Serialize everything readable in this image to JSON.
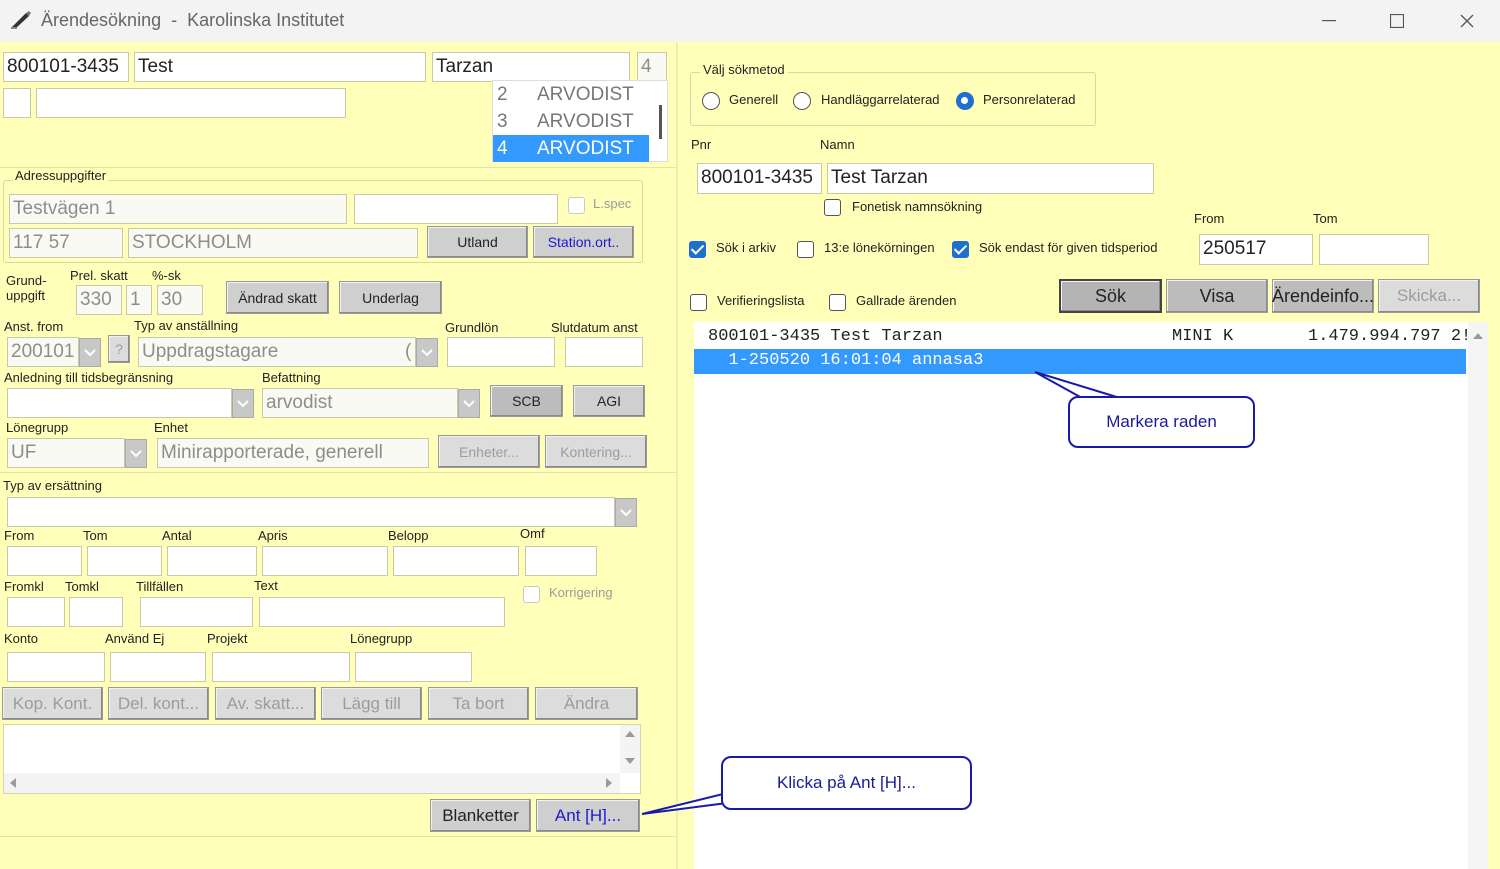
{
  "window": {
    "title": "Ärendesökning",
    "title_sep": "-",
    "title_org": "Karolinska Institutet"
  },
  "left": {
    "pnr": "800101-3435",
    "first_name": "Test",
    "last_name": "Tarzan",
    "count": "4",
    "list": [
      {
        "num": "2",
        "text": "ARVODIST"
      },
      {
        "num": "3",
        "text": "ARVODIST"
      },
      {
        "num": "4",
        "text": "ARVODIST"
      }
    ],
    "address_group": "Adressuppgifter",
    "street": "Testvägen 1",
    "lspec": "L.spec",
    "zip": "117 57",
    "city": "STOCKHOLM",
    "btn_utland": "Utland",
    "btn_stationort": "Station.ort..",
    "grund_label": "Grund-\nuppgift",
    "grund_l1": "Grund-",
    "grund_l2": "uppgift",
    "prel_skatt_label": "Prel. skatt",
    "pct_label": "%-sk",
    "prel_skatt": "330",
    "prel_one": "1",
    "pct": "30",
    "btn_andrad_skatt": "Ändrad skatt",
    "btn_underlag": "Underlag",
    "anst_from_label": "Anst. from",
    "typ_label": "Typ av anställning",
    "grundlon_label": "Grundlön",
    "slutdatum_label": "Slutdatum anst",
    "anst_from": "200101",
    "q_mark": "?",
    "typ": "Uppdragstagare",
    "typ_suffix": "(",
    "anledning_label": "Anledning till tidsbegränsning",
    "befattning_label": "Befattning",
    "befattning": "arvodist",
    "btn_scb": "SCB",
    "btn_agi": "AGI",
    "lonegrupp_label": "Lönegrupp",
    "enhet_label": "Enhet",
    "lonegrupp": "UF",
    "enhet": "Minirapporterade, generell",
    "btn_enheter": "Enheter...",
    "btn_kontering": "Kontering...",
    "ersattning_label": "Typ av ersättning",
    "from_label": "From",
    "tom_label": "Tom",
    "antal_label": "Antal",
    "apris_label": "Apris",
    "belopp_label": "Belopp",
    "omf_label": "Omf",
    "fromkl_label": "Fromkl",
    "tomkl_label": "Tomkl",
    "tillfallen_label": "Tillfällen",
    "text_label": "Text",
    "korrigering_label": "Korrigering",
    "konto_label": "Konto",
    "anvand_ej_label": "Använd Ej",
    "projekt_label": "Projekt",
    "lonegrupp2_label": "Lönegrupp",
    "btn_kop_kont": "Kop. Kont.",
    "btn_del_kont": "Del. kont...",
    "btn_av_skatt": "Av. skatt...",
    "btn_lagg_till": "Lägg till",
    "btn_ta_bort": "Ta bort",
    "btn_andra": "Ändra",
    "btn_blanketter": "Blanketter",
    "btn_ant": "Ant [H]..."
  },
  "right": {
    "method_group": "Välj sökmetod",
    "radio_generell": "Generell",
    "radio_handl": "Handläggarrelaterad",
    "radio_person": "Personrelaterad",
    "pnr_label": "Pnr",
    "namn_label": "Namn",
    "pnr": "800101-3435",
    "namn": "Test Tarzan",
    "fonetisk": "Fonetisk namnsökning",
    "from_label": "From",
    "tom_label": "Tom",
    "sok_arkiv": "Sök i arkiv",
    "lonekorningen": "13:e lönekörningen",
    "sok_endast": "Sök endast för given tidsperiod",
    "from_value": "250517",
    "verifieringslista": "Verifieringslista",
    "gallrade": "Gallrade ärenden",
    "btn_sok": "Sök",
    "btn_visa": "Visa",
    "btn_arendeinfo": "Ärendeinfo...",
    "btn_skicka": "Skicka...",
    "results": [
      {
        "col1": "800101-3435 Test Tarzan",
        "col2": "MINI K",
        "col3": "1.479.994.797 2!"
      },
      {
        "col1": "  1-250520 16:01:04 annasa3",
        "col2": "",
        "col3": ""
      }
    ]
  },
  "callouts": {
    "markera": "Markera raden",
    "klicka": "Klicka på Ant [H]..."
  },
  "colors": {
    "background": "#ffffb9",
    "selection": "#3399ff",
    "callout_border": "#1a1aa8"
  }
}
